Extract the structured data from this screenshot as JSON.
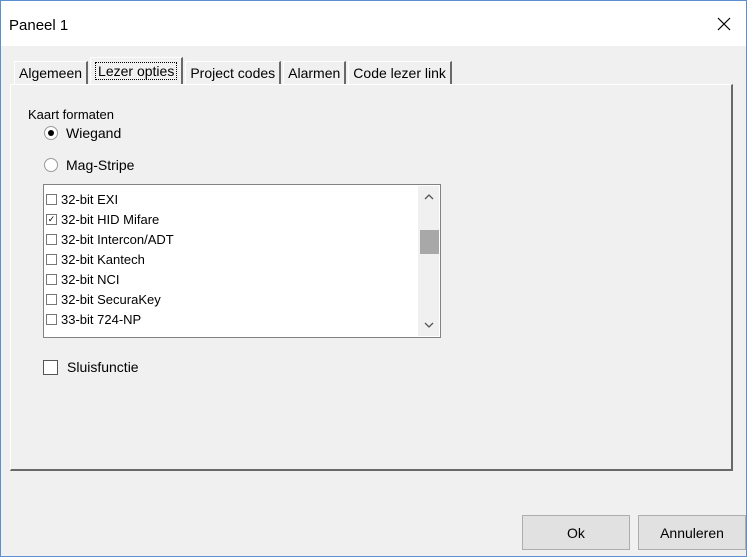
{
  "window": {
    "title": "Paneel 1"
  },
  "tabs": [
    {
      "label": "Algemeen",
      "active": false
    },
    {
      "label": "Lezer opties",
      "active": true
    },
    {
      "label": "Project codes",
      "active": false
    },
    {
      "label": "Alarmen",
      "active": false
    },
    {
      "label": "Code lezer link",
      "active": false
    }
  ],
  "card_formats": {
    "group_label": "Kaart formaten",
    "options": [
      {
        "label": "Wiegand",
        "selected": true
      },
      {
        "label": "Mag-Stripe",
        "selected": false
      }
    ]
  },
  "format_list": {
    "items": [
      {
        "label": "32-bit EXI",
        "checked": false
      },
      {
        "label": "32-bit HID Mifare",
        "checked": true
      },
      {
        "label": "32-bit Intercon/ADT",
        "checked": false
      },
      {
        "label": "32-bit Kantech",
        "checked": false
      },
      {
        "label": "32-bit NCI",
        "checked": false
      },
      {
        "label": "32-bit SecuraKey",
        "checked": false
      },
      {
        "label": "33-bit 724-NP",
        "checked": false
      }
    ]
  },
  "sluis": {
    "label": "Sluisfunctie",
    "checked": false
  },
  "buttons": {
    "ok": "Ok",
    "cancel": "Annuleren"
  },
  "colors": {
    "border_accent": "#5b8fd0",
    "background": "#f0f0f0"
  }
}
